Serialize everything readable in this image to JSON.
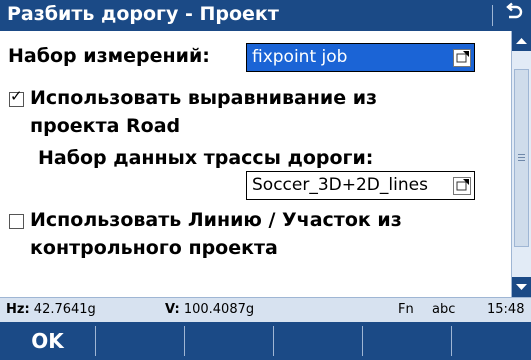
{
  "title": "Разбить дорогу - Проект",
  "back_icon": "return-arrow-icon",
  "form": {
    "measurement_set_label": "Набор измерений:",
    "measurement_set_value": "fixpoint job",
    "use_alignment_checked": true,
    "use_alignment_label_line1": "Использовать выравнивание из",
    "use_alignment_label_line2": "проекта Road",
    "road_dataset_label": "Набор данных трассы дороги:",
    "road_dataset_value": "Soccer_3D+2D_lines",
    "use_line_checked": false,
    "use_line_label_line1": "Использовать Линию / Участок из",
    "use_line_label_line2": "контрольного проекта"
  },
  "status": {
    "hz_label": "Hz:",
    "hz_value": "42.7641g",
    "v_label": "V:",
    "v_value": "100.4087g",
    "fn": "Fn",
    "input_mode": "abc",
    "time": "15:48"
  },
  "softkeys": [
    "OK",
    "",
    "",
    "",
    "",
    ""
  ],
  "colors": {
    "titlebar": "#1b4a86",
    "selected_field": "#1b64d6",
    "statusbar": "#d7e2f0",
    "scrollbar": "#e2ebf6"
  }
}
